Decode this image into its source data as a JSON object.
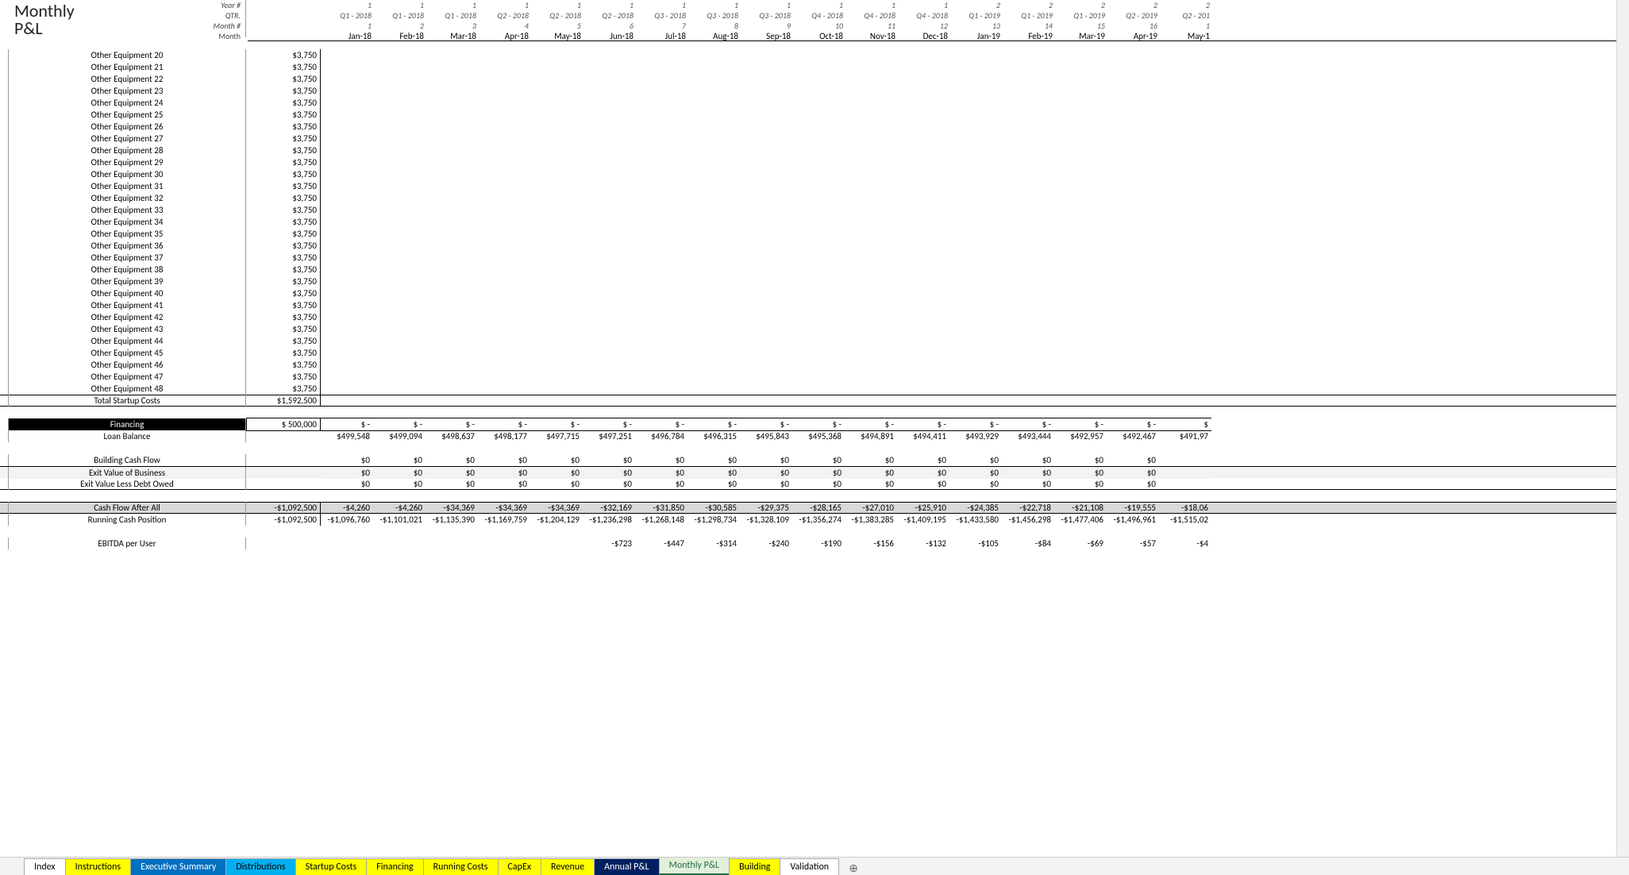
{
  "title_line1": "Monthly",
  "title_line2": "P&L",
  "header_labels": {
    "year": "Year #",
    "qtr": "QTR.",
    "monthno": "Month #",
    "month": "Month"
  },
  "columns": [
    {
      "year": "1",
      "qtr": "Q1 - 2018",
      "mno": "1",
      "mon": "Jan-18"
    },
    {
      "year": "1",
      "qtr": "Q1 - 2018",
      "mno": "2",
      "mon": "Feb-18"
    },
    {
      "year": "1",
      "qtr": "Q1 - 2018",
      "mno": "3",
      "mon": "Mar-18"
    },
    {
      "year": "1",
      "qtr": "Q2 - 2018",
      "mno": "4",
      "mon": "Apr-18"
    },
    {
      "year": "1",
      "qtr": "Q2 - 2018",
      "mno": "5",
      "mon": "May-18"
    },
    {
      "year": "1",
      "qtr": "Q2 - 2018",
      "mno": "6",
      "mon": "Jun-18"
    },
    {
      "year": "1",
      "qtr": "Q3 - 2018",
      "mno": "7",
      "mon": "Jul-18"
    },
    {
      "year": "1",
      "qtr": "Q3 - 2018",
      "mno": "8",
      "mon": "Aug-18"
    },
    {
      "year": "1",
      "qtr": "Q3 - 2018",
      "mno": "9",
      "mon": "Sep-18"
    },
    {
      "year": "1",
      "qtr": "Q4 - 2018",
      "mno": "10",
      "mon": "Oct-18"
    },
    {
      "year": "1",
      "qtr": "Q4 - 2018",
      "mno": "11",
      "mon": "Nov-18"
    },
    {
      "year": "1",
      "qtr": "Q4 - 2018",
      "mno": "12",
      "mon": "Dec-18"
    },
    {
      "year": "2",
      "qtr": "Q1 - 2019",
      "mno": "13",
      "mon": "Jan-19"
    },
    {
      "year": "2",
      "qtr": "Q1 - 2019",
      "mno": "14",
      "mon": "Feb-19"
    },
    {
      "year": "2",
      "qtr": "Q1 - 2019",
      "mno": "15",
      "mon": "Mar-19"
    },
    {
      "year": "2",
      "qtr": "Q2 - 2019",
      "mno": "16",
      "mon": "Apr-19"
    },
    {
      "year": "2",
      "qtr": "Q2 - 201",
      "mno": "1",
      "mon": "May-1"
    }
  ],
  "equipment_rows": [
    {
      "label": "Other Equipment 20",
      "amount": "$3,750"
    },
    {
      "label": "Other Equipment 21",
      "amount": "$3,750"
    },
    {
      "label": "Other Equipment 22",
      "amount": "$3,750"
    },
    {
      "label": "Other Equipment 23",
      "amount": "$3,750"
    },
    {
      "label": "Other Equipment 24",
      "amount": "$3,750"
    },
    {
      "label": "Other Equipment 25",
      "amount": "$3,750"
    },
    {
      "label": "Other Equipment 26",
      "amount": "$3,750"
    },
    {
      "label": "Other Equipment 27",
      "amount": "$3,750"
    },
    {
      "label": "Other Equipment 28",
      "amount": "$3,750"
    },
    {
      "label": "Other Equipment 29",
      "amount": "$3,750"
    },
    {
      "label": "Other Equipment 30",
      "amount": "$3,750"
    },
    {
      "label": "Other Equipment 31",
      "amount": "$3,750"
    },
    {
      "label": "Other Equipment 32",
      "amount": "$3,750"
    },
    {
      "label": "Other Equipment 33",
      "amount": "$3,750"
    },
    {
      "label": "Other Equipment 34",
      "amount": "$3,750"
    },
    {
      "label": "Other Equipment 35",
      "amount": "$3,750"
    },
    {
      "label": "Other Equipment 36",
      "amount": "$3,750"
    },
    {
      "label": "Other Equipment 37",
      "amount": "$3,750"
    },
    {
      "label": "Other Equipment 38",
      "amount": "$3,750"
    },
    {
      "label": "Other Equipment 39",
      "amount": "$3,750"
    },
    {
      "label": "Other Equipment 40",
      "amount": "$3,750"
    },
    {
      "label": "Other Equipment 41",
      "amount": "$3,750"
    },
    {
      "label": "Other Equipment 42",
      "amount": "$3,750"
    },
    {
      "label": "Other Equipment 43",
      "amount": "$3,750"
    },
    {
      "label": "Other Equipment 44",
      "amount": "$3,750"
    },
    {
      "label": "Other Equipment 45",
      "amount": "$3,750"
    },
    {
      "label": "Other Equipment 46",
      "amount": "$3,750"
    },
    {
      "label": "Other Equipment 47",
      "amount": "$3,750"
    },
    {
      "label": "Other Equipment 48",
      "amount": "$3,750"
    }
  ],
  "total_startup": {
    "label": "Total Startup Costs",
    "amount": "$1,592,500"
  },
  "financing": {
    "header": "Financing",
    "amount_first": "$           500,000",
    "dash_row": [
      "$              -",
      "$              -",
      "$              -",
      "$              -",
      "$              -",
      "$              -",
      "$              -",
      "$              -",
      "$              -",
      "$              -",
      "$              -",
      "$              -",
      "$              -",
      "$              -",
      "$              -",
      "$              -",
      "$"
    ]
  },
  "loan_balance": {
    "label": "Loan Balance",
    "values": [
      "",
      "$499,548",
      "$499,094",
      "$498,637",
      "$498,177",
      "$497,715",
      "$497,251",
      "$496,784",
      "$496,315",
      "$495,843",
      "$495,368",
      "$494,891",
      "$494,411",
      "$493,929",
      "$493,444",
      "$492,957",
      "$492,467",
      "$491,97"
    ]
  },
  "building_cf": {
    "label": "Building Cash Flow",
    "values": [
      "",
      "$0",
      "$0",
      "$0",
      "$0",
      "$0",
      "$0",
      "$0",
      "$0",
      "$0",
      "$0",
      "$0",
      "$0",
      "$0",
      "$0",
      "$0",
      "$0",
      ""
    ]
  },
  "exit_value_biz": {
    "label": "Exit Value of Business",
    "values": [
      "",
      "$0",
      "$0",
      "$0",
      "$0",
      "$0",
      "$0",
      "$0",
      "$0",
      "$0",
      "$0",
      "$0",
      "$0",
      "$0",
      "$0",
      "$0",
      "$0",
      ""
    ]
  },
  "exit_value_debt": {
    "label": "Exit Value Less Debt Owed",
    "values": [
      "",
      "$0",
      "$0",
      "$0",
      "$0",
      "$0",
      "$0",
      "$0",
      "$0",
      "$0",
      "$0",
      "$0",
      "$0",
      "$0",
      "$0",
      "$0",
      "$0",
      ""
    ]
  },
  "cfaa": {
    "label": "Cash Flow After All",
    "values": [
      "-$1,092,500",
      "-$4,260",
      "-$4,260",
      "-$34,369",
      "-$34,369",
      "-$34,369",
      "-$32,169",
      "-$31,850",
      "-$30,585",
      "-$29,375",
      "-$28,165",
      "-$27,010",
      "-$25,910",
      "-$24,385",
      "-$22,718",
      "-$21,108",
      "-$19,555",
      "-$18,06"
    ]
  },
  "running_cash": {
    "label": "Running Cash Position",
    "values": [
      "-$1,092,500",
      "-$1,096,760",
      "-$1,101,021",
      "-$1,135,390",
      "-$1,169,759",
      "-$1,204,129",
      "-$1,236,298",
      "-$1,268,148",
      "-$1,298,734",
      "-$1,328,109",
      "-$1,356,274",
      "-$1,383,285",
      "-$1,409,195",
      "-$1,433,580",
      "-$1,456,298",
      "-$1,477,406",
      "-$1,496,961",
      "-$1,515,02"
    ]
  },
  "ebitda": {
    "label": "EBITDA per User",
    "values": [
      "",
      "",
      "",
      "",
      "",
      "",
      "-$723",
      "-$447",
      "-$314",
      "-$240",
      "-$190",
      "-$156",
      "-$132",
      "-$105",
      "-$84",
      "-$69",
      "-$57",
      "-$4"
    ]
  },
  "tabs": [
    {
      "label": "Index",
      "cls": ""
    },
    {
      "label": "Instructions",
      "cls": "yellow"
    },
    {
      "label": "Executive Summary",
      "cls": "blue-dk"
    },
    {
      "label": "Distributions",
      "cls": "blue-lt"
    },
    {
      "label": "Startup Costs",
      "cls": "yellow"
    },
    {
      "label": "Financing",
      "cls": "yellow"
    },
    {
      "label": "Running Costs",
      "cls": "yellow"
    },
    {
      "label": "CapEx",
      "cls": "yellow"
    },
    {
      "label": "Revenue",
      "cls": "yellow"
    },
    {
      "label": "Annual P&L",
      "cls": "navy"
    },
    {
      "label": "Monthly P&L",
      "cls": "green active"
    },
    {
      "label": "Building",
      "cls": "yellow"
    },
    {
      "label": "Validation",
      "cls": ""
    }
  ]
}
